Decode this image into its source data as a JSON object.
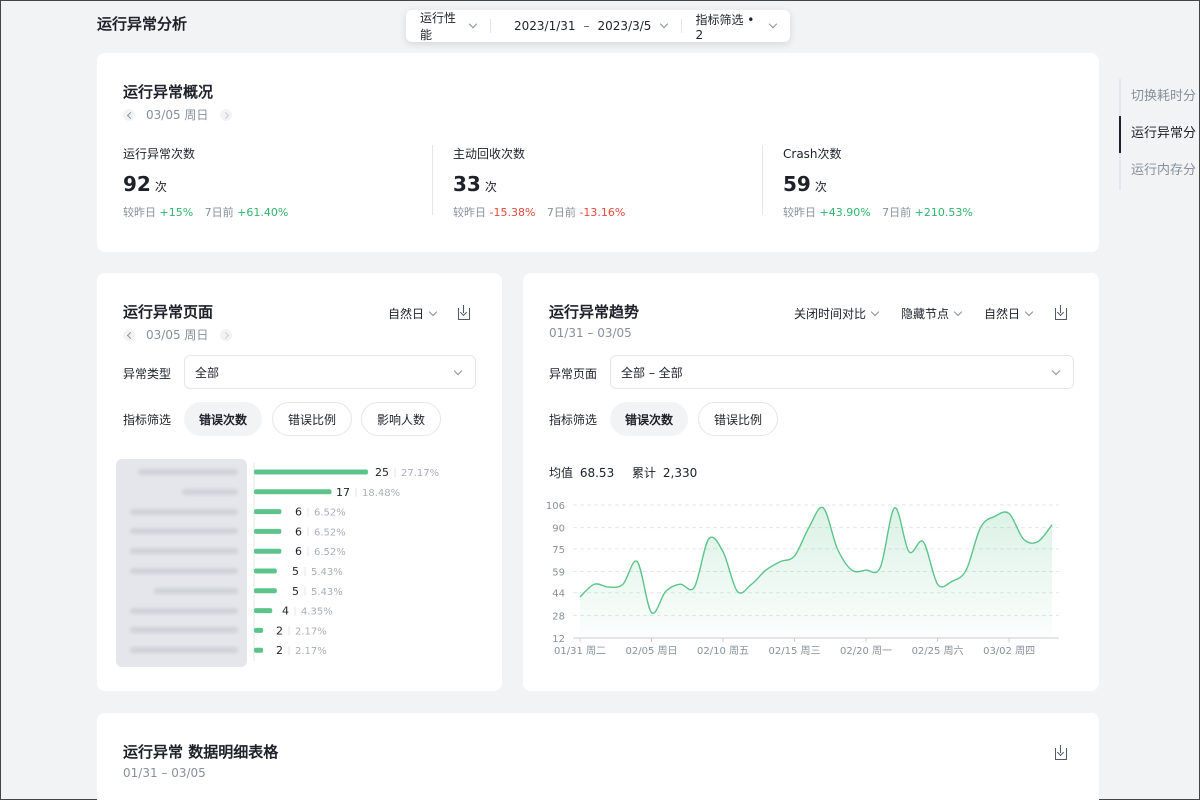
{
  "page": {
    "title": "运行异常分析"
  },
  "filter_bar": {
    "metric": "运行性能",
    "date_start": "2023/1/31",
    "date_sep": "–",
    "date_end": "2023/3/5",
    "indicator": "指标筛选 • 2"
  },
  "overview": {
    "title": "运行异常概况",
    "date": "03/05 周日",
    "kpis": [
      {
        "label": "运行异常次数",
        "value": "92",
        "unit": "次",
        "dod_label": "较昨日",
        "dod": "+15%",
        "dod_dir": "up",
        "wow_label": "7日前",
        "wow": "+61.40%",
        "wow_dir": "up"
      },
      {
        "label": "主动回收次数",
        "value": "33",
        "unit": "次",
        "dod_label": "较昨日",
        "dod": "-15.38%",
        "dod_dir": "down",
        "wow_label": "7日前",
        "wow": "-13.16%",
        "wow_dir": "down"
      },
      {
        "label": "Crash次数",
        "value": "59",
        "unit": "次",
        "dod_label": "较昨日",
        "dod": "+43.90%",
        "dod_dir": "up",
        "wow_label": "7日前",
        "wow": "+210.53%",
        "wow_dir": "up"
      }
    ]
  },
  "right_nav": {
    "items": [
      "切换耗时分",
      "运行异常分",
      "运行内存分"
    ],
    "active_index": 1
  },
  "pages_card": {
    "title": "运行异常页面",
    "date": "03/05 周日",
    "granularity": "自然日",
    "type_label": "异常类型",
    "type_value": "全部",
    "filter_label": "指标筛选",
    "pills": [
      "错误次数",
      "错误比例",
      "影响人数"
    ],
    "active_pill": 0,
    "bars": [
      {
        "count": "25",
        "pct": "27.17%",
        "value": 25
      },
      {
        "count": "17",
        "pct": "18.48%",
        "value": 17
      },
      {
        "count": "6",
        "pct": "6.52%",
        "value": 6
      },
      {
        "count": "6",
        "pct": "6.52%",
        "value": 6
      },
      {
        "count": "6",
        "pct": "6.52%",
        "value": 6
      },
      {
        "count": "5",
        "pct": "5.43%",
        "value": 5
      },
      {
        "count": "5",
        "pct": "5.43%",
        "value": 5
      },
      {
        "count": "4",
        "pct": "4.35%",
        "value": 4
      },
      {
        "count": "2",
        "pct": "2.17%",
        "value": 2
      },
      {
        "count": "2",
        "pct": "2.17%",
        "value": 2
      }
    ],
    "bar_color": "#5cc48a"
  },
  "trend_card": {
    "title": "运行异常趋势",
    "date_range": "01/31 – 03/05",
    "controls": [
      "关闭时间对比",
      "隐藏节点",
      "自然日"
    ],
    "page_label": "异常页面",
    "page_value": "全部 – 全部",
    "filter_label": "指标筛选",
    "pills": [
      "错误次数",
      "错误比例"
    ],
    "active_pill": 0,
    "avg_label": "均值",
    "avg_value": "68.53",
    "sum_label": "累计",
    "sum_value": "2,330"
  },
  "chart_data": {
    "type": "line",
    "y_ticks": [
      106,
      90,
      75,
      59,
      44,
      28,
      12
    ],
    "ylim": [
      12,
      106
    ],
    "x_tick_labels": [
      "01/31 周二",
      "02/05 周日",
      "02/10 周五",
      "02/15 周三",
      "02/20 周一",
      "02/25 周六",
      "03/02 周四"
    ],
    "x_tick_index": [
      0,
      5,
      10,
      15,
      20,
      25,
      30
    ],
    "x": [
      "01/31",
      "02/01",
      "02/02",
      "02/03",
      "02/04",
      "02/05",
      "02/06",
      "02/07",
      "02/08",
      "02/09",
      "02/10",
      "02/11",
      "02/12",
      "02/13",
      "02/14",
      "02/15",
      "02/16",
      "02/17",
      "02/18",
      "02/19",
      "02/20",
      "02/21",
      "02/22",
      "02/23",
      "02/24",
      "02/25",
      "02/26",
      "02/27",
      "02/28",
      "03/01",
      "03/02",
      "03/03",
      "03/04",
      "03/05"
    ],
    "values": [
      41,
      50,
      48,
      50,
      66,
      30,
      45,
      50,
      48,
      82,
      73,
      45,
      50,
      60,
      66,
      70,
      90,
      104,
      75,
      60,
      60,
      62,
      104,
      73,
      80,
      50,
      52,
      60,
      90,
      98,
      100,
      82,
      80,
      92
    ],
    "line_color": "#5cc48a",
    "grid": true
  },
  "detail_card": {
    "title": "运行异常 数据明细表格",
    "date_range": "01/31 – 03/05"
  }
}
